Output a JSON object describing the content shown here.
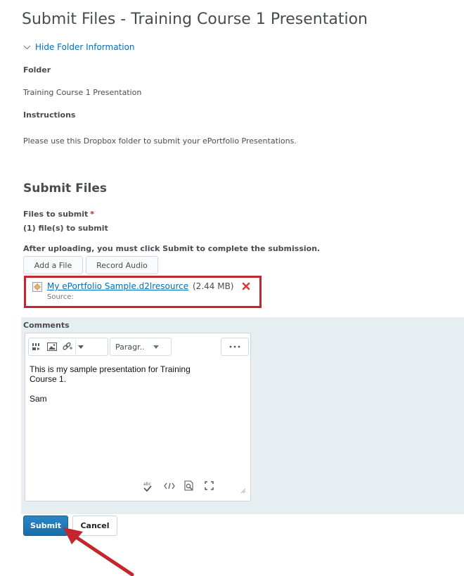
{
  "page": {
    "title": "Submit Files - Training Course 1 Presentation",
    "toggle_label": "Hide Folder Information"
  },
  "folder_info": {
    "folder_label": "Folder",
    "folder_value": "Training Course 1 Presentation",
    "instructions_label": "Instructions",
    "instructions_value": "Please use this Dropbox folder to submit your ePortfolio Presentations."
  },
  "submit_files": {
    "heading": "Submit Files",
    "files_label": "Files to submit",
    "required_marker": "*",
    "file_count": "(1) file(s) to submit",
    "notice": "After uploading, you must click Submit to complete the submission.",
    "add_file_label": "Add a File",
    "record_audio_label": "Record Audio",
    "file": {
      "name": "My ePortfolio Sample.d2lresource",
      "size": "(2.44 MB)",
      "source_label": "Source:"
    }
  },
  "comments": {
    "label": "Comments",
    "format_select": "Paragr..",
    "text_lines": [
      "This is my sample presentation for Training",
      "Course 1.",
      "",
      "Sam"
    ]
  },
  "actions": {
    "submit_label": "Submit",
    "cancel_label": "Cancel"
  },
  "colors": {
    "accent": "#006fbf",
    "highlight": "#c1272d",
    "panel": "#e7eef1"
  }
}
